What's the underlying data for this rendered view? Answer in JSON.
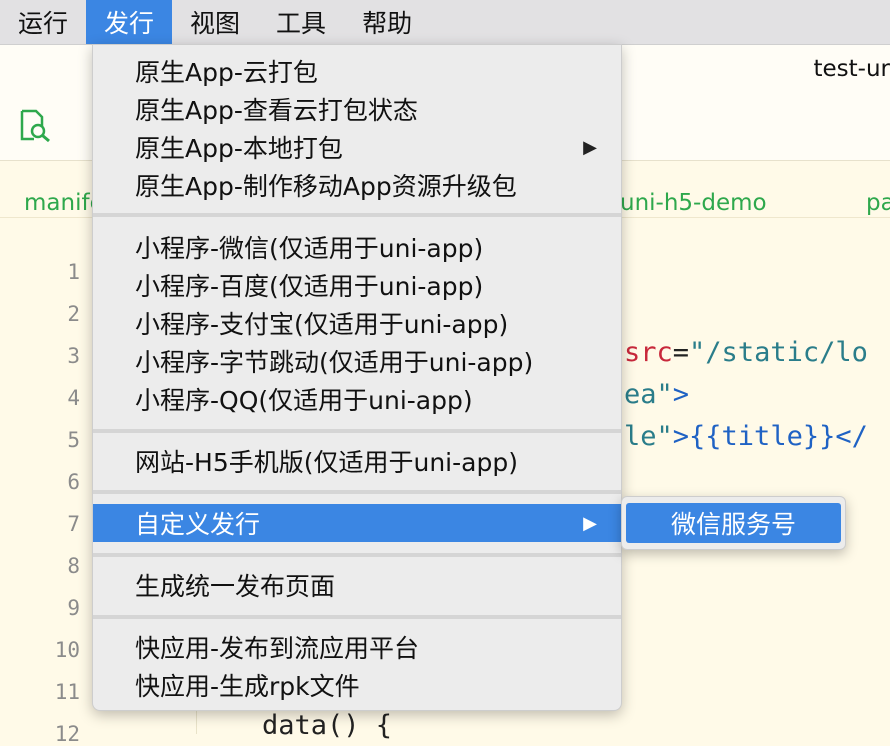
{
  "menubar": {
    "items": [
      {
        "label": "运行",
        "active": false
      },
      {
        "label": "发行",
        "active": true
      },
      {
        "label": "视图",
        "active": false
      },
      {
        "label": "工具",
        "active": false
      },
      {
        "label": "帮助",
        "active": false
      }
    ]
  },
  "window": {
    "title": "test-ur"
  },
  "tabs": [
    {
      "label": "manife"
    },
    {
      "label": "uni-h5-demo"
    },
    {
      "label": "pa"
    }
  ],
  "gutter": {
    "line_numbers": [
      "1",
      "2",
      "3",
      "4",
      "5",
      "6",
      "7",
      "8",
      "9",
      "10",
      "11",
      "12"
    ]
  },
  "code": {
    "line3_attr": "src",
    "line3_eq": "=",
    "line3_value": "\"/static/lo",
    "line4_value": "ea\"",
    "line4_close": ">",
    "line5_value": "le\"",
    "line5_rest": ">{{title}}</",
    "line12": "data() {"
  },
  "dropdown": {
    "groups": [
      {
        "items": [
          {
            "label": "原生App-云打包",
            "submenu": false
          },
          {
            "label": "原生App-查看云打包状态",
            "submenu": false
          },
          {
            "label": "原生App-本地打包",
            "submenu": true
          },
          {
            "label": "原生App-制作移动App资源升级包",
            "submenu": false
          }
        ]
      },
      {
        "items": [
          {
            "label": "小程序-微信(仅适用于uni-app)",
            "submenu": false
          },
          {
            "label": "小程序-百度(仅适用于uni-app)",
            "submenu": false
          },
          {
            "label": "小程序-支付宝(仅适用于uni-app)",
            "submenu": false
          },
          {
            "label": "小程序-字节跳动(仅适用于uni-app)",
            "submenu": false
          },
          {
            "label": "小程序-QQ(仅适用于uni-app)",
            "submenu": false
          }
        ]
      },
      {
        "items": [
          {
            "label": "网站-H5手机版(仅适用于uni-app)",
            "submenu": false
          }
        ]
      },
      {
        "items": [
          {
            "label": "自定义发行",
            "submenu": true,
            "highlighted": true
          }
        ]
      },
      {
        "items": [
          {
            "label": "生成统一发布页面",
            "submenu": false
          }
        ]
      },
      {
        "items": [
          {
            "label": "快应用-发布到流应用平台",
            "submenu": false
          },
          {
            "label": "快应用-生成rpk文件",
            "submenu": false
          }
        ]
      }
    ],
    "arrow_glyph": "▶"
  },
  "submenu": {
    "label": "微信服务号"
  },
  "colors": {
    "highlight": "#3b86e3",
    "tab_green": "#2ea84c"
  },
  "icons": {
    "toolbar": "file-search-icon"
  }
}
